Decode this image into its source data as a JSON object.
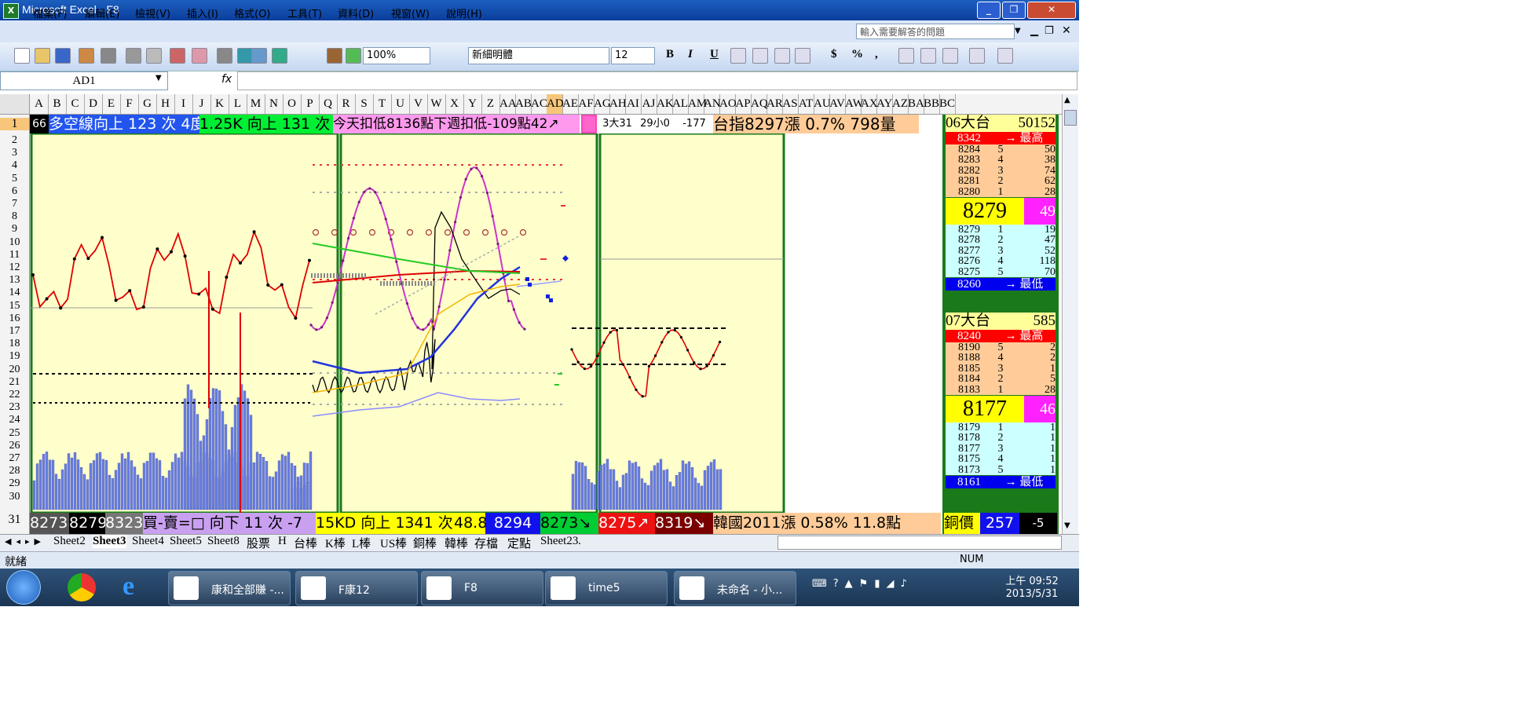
{
  "window": {
    "title": "Microsoft Excel - F8",
    "app_icon_glyph": "X"
  },
  "menu": {
    "items": [
      "檔案(F)",
      "編輯(E)",
      "檢視(V)",
      "插入(I)",
      "格式(O)",
      "工具(T)",
      "資料(D)",
      "視窗(W)",
      "說明(H)"
    ],
    "help_placeholder": "輸入需要解答的問題"
  },
  "toolbar": {
    "zoom": "100%",
    "font": "新細明體",
    "font_size": "12",
    "bold": "B",
    "italic": "I",
    "underline": "U",
    "currency": "$",
    "percent": "%",
    "comma": ","
  },
  "formula_bar": {
    "name_box": "AD1",
    "fx": "fx",
    "content": ""
  },
  "columns": [
    "A",
    "B",
    "C",
    "D",
    "E",
    "F",
    "G",
    "H",
    "I",
    "J",
    "K",
    "L",
    "M",
    "N",
    "O",
    "P",
    "Q",
    "R",
    "S",
    "T",
    "U",
    "V",
    "W",
    "X",
    "Y",
    "Z",
    "AA",
    "AB",
    "AC",
    "AD",
    "AE",
    "AF",
    "AG",
    "AH",
    "AI",
    "AJ",
    "AK",
    "AL",
    "AM",
    "AN",
    "AO",
    "AP",
    "AQ",
    "AR",
    "AS",
    "AT",
    "AU",
    "AV",
    "AW",
    "AX",
    "AY",
    "AZ",
    "BA",
    "BB",
    "BC"
  ],
  "rows": [
    "1",
    "2",
    "3",
    "4",
    "5",
    "6",
    "7",
    "8",
    "9",
    "10",
    "11",
    "12",
    "13",
    "14",
    "15",
    "16",
    "17",
    "18",
    "19",
    "20",
    "21",
    "22",
    "23",
    "24",
    "25",
    "26",
    "27",
    "28",
    "29",
    "30",
    "31"
  ],
  "row1": {
    "a": "66",
    "b": "多空線向上 123 次 4度",
    "c": "1.25K 向上 131 次",
    "d": "今天扣低8136點下週扣低-109點42↗",
    "e": "3大31",
    "f": "29小0",
    "g": "-177",
    "h": "台指8297漲 0.7% 798量"
  },
  "row31": {
    "a": "8273",
    "b": "8279",
    "c": "8323",
    "d": "買-賣=□ 向下 11 次 -7",
    "e": "15KD 向上 1341 次",
    "f": "48.8",
    "g": "8294",
    "h": "8273↘",
    "i": "8275↗",
    "j": "8319↘",
    "k": "韓國2011漲 0.58% 11.8點",
    "l": "銅價",
    "m": "257",
    "n": "-5"
  },
  "panel": {
    "tx06": {
      "name": "06大台",
      "vol": "50152",
      "high_price": "8342",
      "high_label": "→ 最高",
      "asks": [
        [
          "8284",
          "5",
          "50"
        ],
        [
          "8283",
          "4",
          "38"
        ],
        [
          "8282",
          "3",
          "74"
        ],
        [
          "8281",
          "2",
          "62"
        ],
        [
          "8280",
          "1",
          "28"
        ]
      ],
      "last": "8279",
      "last_vol": "49",
      "bids": [
        [
          "8279",
          "1",
          "19"
        ],
        [
          "8278",
          "2",
          "47"
        ],
        [
          "8277",
          "3",
          "52"
        ],
        [
          "8276",
          "4",
          "118"
        ],
        [
          "8275",
          "5",
          "70"
        ]
      ],
      "low_price": "8260",
      "low_label": "→ 最低"
    },
    "tx07": {
      "name": "07大台",
      "vol": "585",
      "high_price": "8240",
      "high_label": "→ 最高",
      "asks": [
        [
          "8190",
          "5",
          "2"
        ],
        [
          "8188",
          "4",
          "2"
        ],
        [
          "8185",
          "3",
          "1"
        ],
        [
          "8184",
          "2",
          "5"
        ],
        [
          "8183",
          "1",
          "28"
        ]
      ],
      "last": "8177",
      "last_vol": "46",
      "bids": [
        [
          "8179",
          "1",
          "1"
        ],
        [
          "8178",
          "2",
          "1"
        ],
        [
          "8177",
          "3",
          "1"
        ],
        [
          "8175",
          "4",
          "1"
        ],
        [
          "8173",
          "5",
          "1"
        ]
      ],
      "low_price": "8161",
      "low_label": "→ 最低"
    }
  },
  "sheet_tabs": [
    "Sheet2",
    "Sheet3",
    "Sheet4",
    "Sheet5",
    "Sheet8",
    "股票",
    "H",
    "台棒",
    "K棒",
    "L棒",
    "US棒",
    "銅棒",
    "韓棒",
    "存檔",
    "定點",
    "Sheet23",
    "."
  ],
  "active_tab": "Sheet3",
  "status": {
    "left": "就緒",
    "num": "NUM"
  },
  "taskbar": {
    "tasks": [
      "康和全部賺 -...",
      "F康12",
      "F8",
      "time5",
      "未命名 - 小..."
    ],
    "time": "上午 09:52",
    "date": "2013/5/31"
  },
  "colors": {
    "chart_bg": "#ffffcc",
    "green_border": "#1a7a1a",
    "line_red": "#e00000",
    "line_magenta": "#cc33cc",
    "bars": "#6b7fe0"
  }
}
